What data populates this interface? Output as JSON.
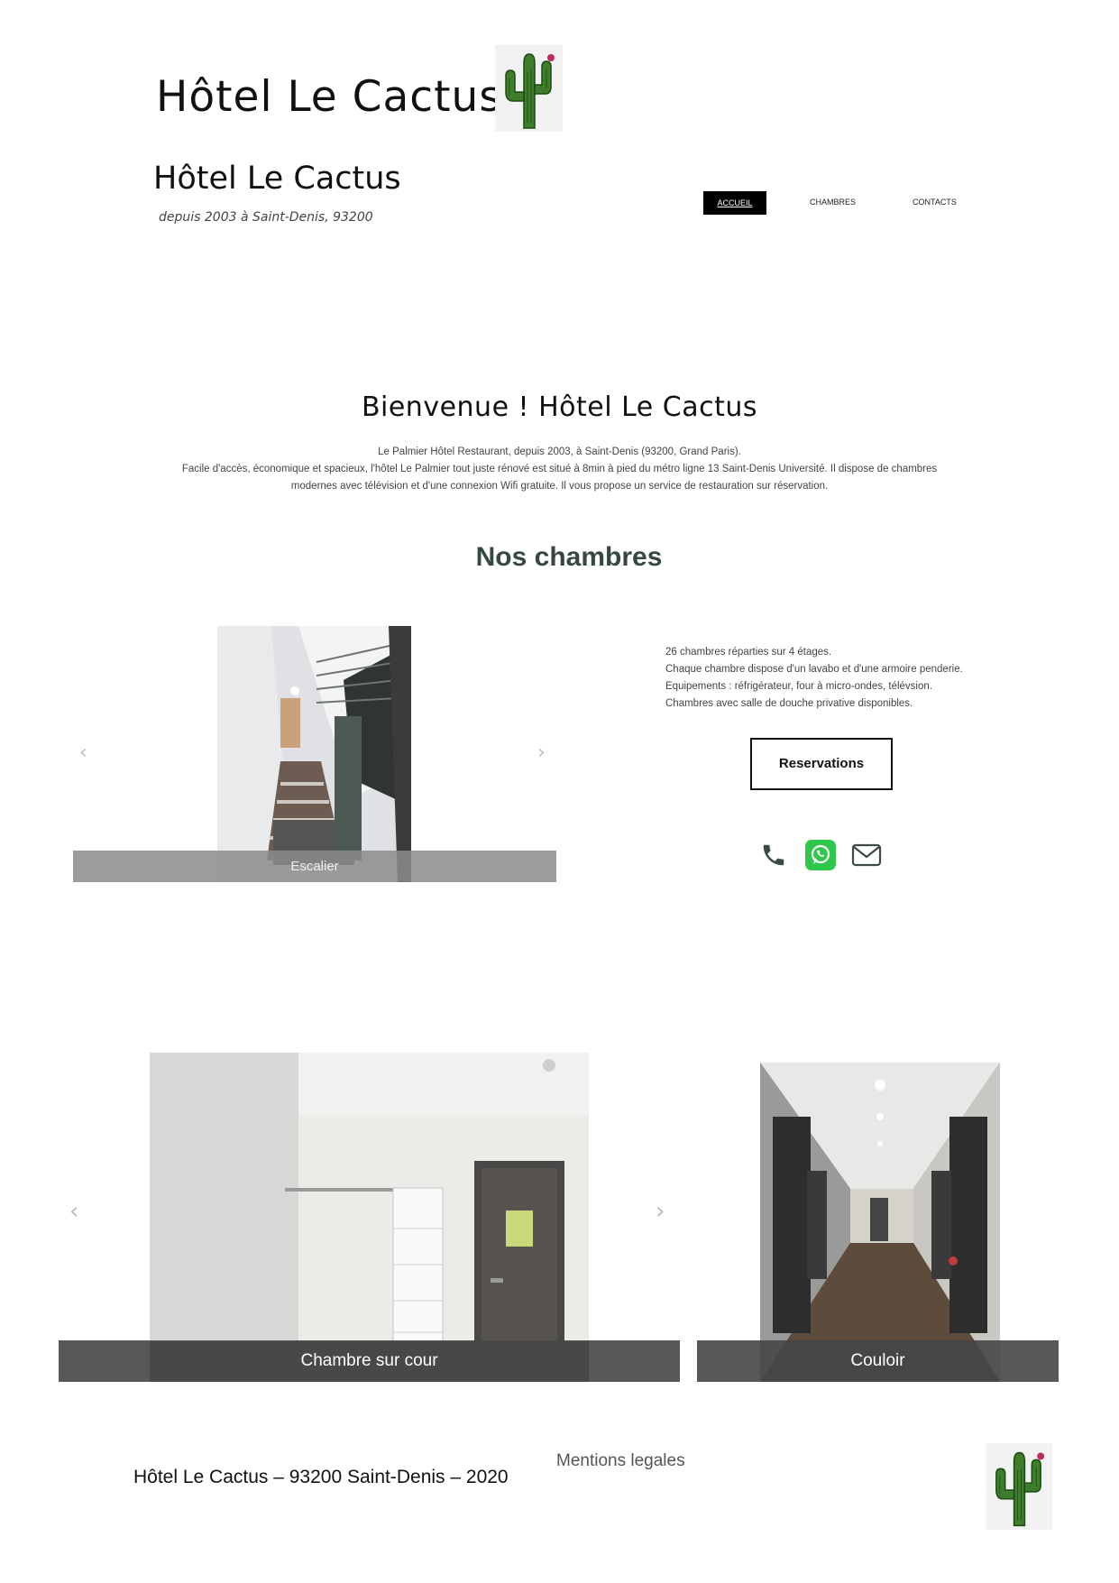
{
  "header": {
    "top_title": "Hôtel Le Cactus",
    "brand_title": "Hôtel Le Cactus",
    "brand_subtitle": "depuis 2003 à Saint-Denis, 93200",
    "nav": [
      {
        "label": "ACCUEIL",
        "active": true
      },
      {
        "label": "CHAMBRES",
        "active": false
      },
      {
        "label": "CONTACTS",
        "active": false
      }
    ]
  },
  "welcome": {
    "title": "Bienvenue ! Hôtel Le Cactus",
    "line1": "Le Palmier Hôtel Restaurant, depuis 2003, à Saint-Denis (93200, Grand Paris).",
    "line2": "Facile d'accès, économique et spacieux, l'hôtel Le Palmier tout juste rénové est situé à 8min à pied du métro ligne 13 Saint-Denis Université. Il dispose de chambres modernes avec télévision et d'une connexion Wifi gratuite. Il vous propose un service de restauration sur réservation."
  },
  "rooms": {
    "title": "Nos chambres",
    "carousel1_caption": "Escalier",
    "info": [
      "26 chambres réparties sur 4 étages.",
      "Chaque chambre dispose d'un lavabo et d'une armoire penderie.",
      "Equipements : réfrigérateur, four à micro-ondes, télévsion.",
      "Chambres avec salle de douche privative disponibles."
    ],
    "reserve_label": "Reservations",
    "contact_icons": [
      "phone-icon",
      "whatsapp-icon",
      "email-icon"
    ],
    "carousel2_caption": "Chambre sur cour",
    "carousel3_caption": "Couloir"
  },
  "footer": {
    "text": "Hôtel Le Cactus – 93200 Saint-Denis – 2020",
    "legal": "Mentions legales"
  },
  "colors": {
    "rooms_title": "#37493f",
    "cactus_green": "#3e7d2a",
    "whatsapp": "#2fc84b"
  }
}
